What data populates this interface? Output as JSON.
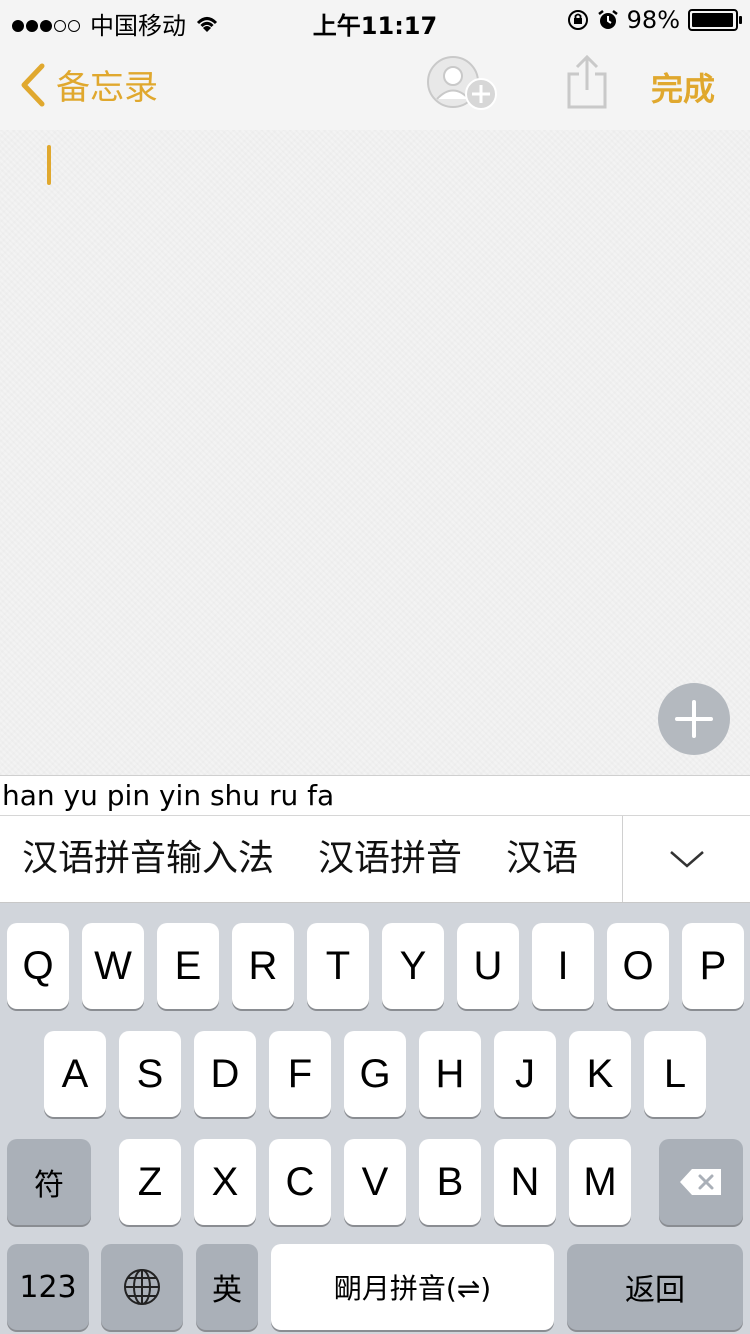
{
  "status_bar": {
    "carrier": "中国移动",
    "time": "上午11:17",
    "battery": "98%",
    "battery_level": 0.98,
    "signal_dots_filled": 3,
    "signal_dots_total": 5
  },
  "nav": {
    "back_label": "备忘录",
    "done_label": "完成",
    "accent_color": "#e0a82e",
    "icons": [
      "chevron-left-icon",
      "add-contact-icon",
      "share-icon"
    ]
  },
  "composition": {
    "text": "han yu pin yin shu ru fa"
  },
  "candidates": {
    "items": [
      "汉语拼音输入法",
      "汉语拼音",
      "汉语"
    ],
    "expand_icon": "chevron-down-icon"
  },
  "keyboard": {
    "row1": [
      "Q",
      "W",
      "E",
      "R",
      "T",
      "Y",
      "U",
      "I",
      "O",
      "P"
    ],
    "row2": [
      "A",
      "S",
      "D",
      "F",
      "G",
      "H",
      "J",
      "K",
      "L"
    ],
    "row3": [
      "Z",
      "X",
      "C",
      "V",
      "B",
      "N",
      "M"
    ],
    "symbols_key": "符",
    "delete_icon": "backspace-icon",
    "numbers_key": "123",
    "globe_icon": "globe-icon",
    "english_key": "英",
    "space_label": "朙月拼音(⇌)",
    "return_label": "返回"
  }
}
